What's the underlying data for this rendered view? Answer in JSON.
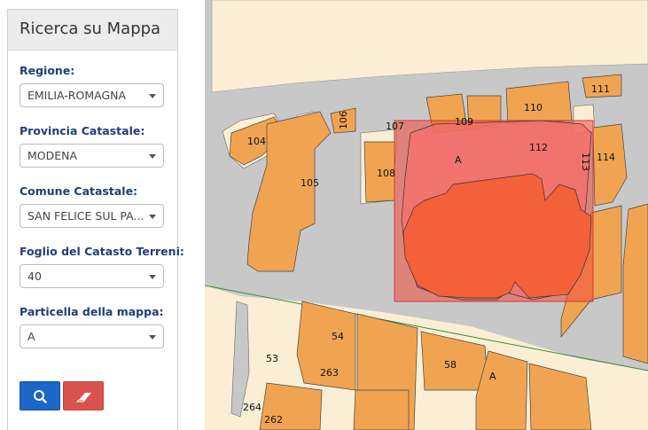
{
  "panel": {
    "title": "Ricerca su Mappa",
    "fields": [
      {
        "label": "Regione:",
        "value": "EMILIA-ROMAGNA"
      },
      {
        "label": "Provincia Catastale:",
        "value": "MODENA"
      },
      {
        "label": "Comune Catastale:",
        "value": "SAN FELICE SUL PA..."
      },
      {
        "label": "Foglio del Catasto Terreni:",
        "value": "40"
      },
      {
        "label": "Particella della mappa:",
        "value": "A"
      }
    ],
    "buttons": {
      "search_icon": "search-icon",
      "clear_icon": "eraser-icon"
    }
  },
  "map": {
    "parcels": [
      "104",
      "105",
      "106",
      "107",
      "108",
      "109",
      "110",
      "111",
      "112",
      "113",
      "114",
      "A",
      "54",
      "53",
      "263",
      "58",
      "A",
      "264",
      "262"
    ],
    "colors": {
      "parcel": "#f0a452",
      "road": "#c8c8c8",
      "sand": "#faefd4",
      "selection": "#f04a3c",
      "building": "#f4603a",
      "panel_header": "#ececec",
      "label_text": "#1f3f77",
      "search_button": "#1b66c6",
      "clear_button": "#d9534f"
    }
  }
}
